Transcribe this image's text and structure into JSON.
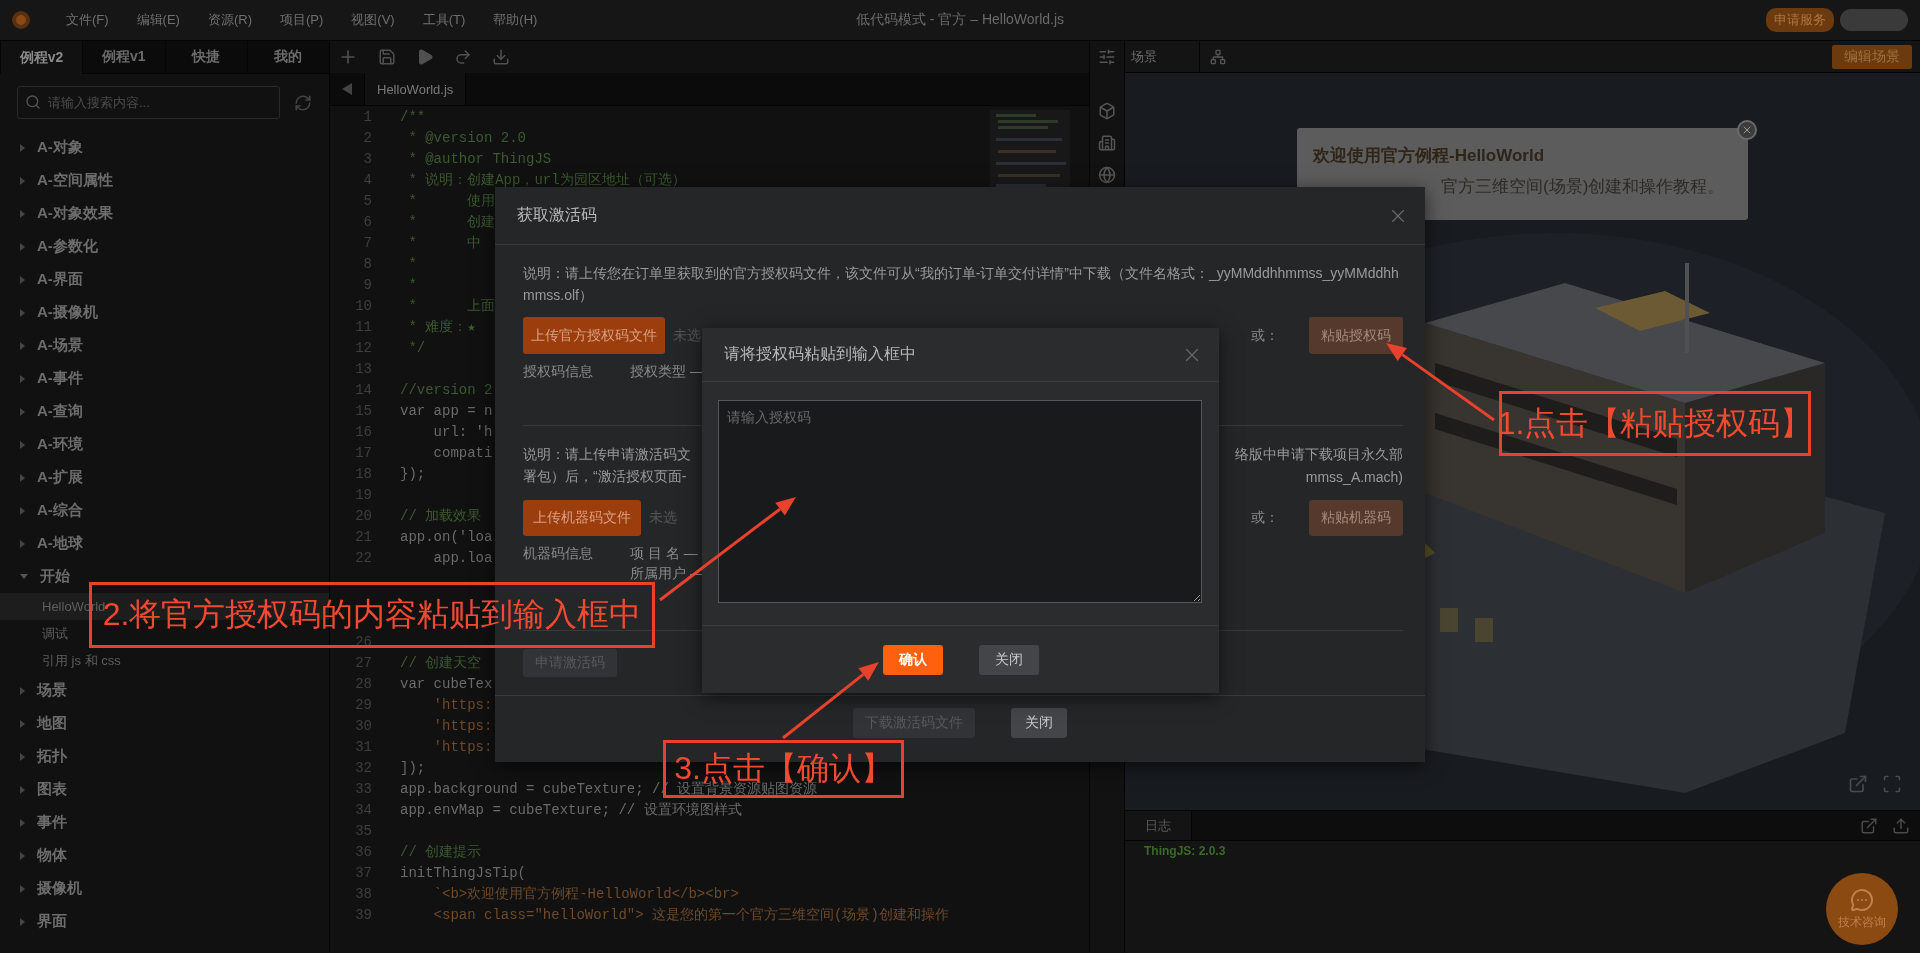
{
  "menu_bar": {
    "items": [
      "文件(F)",
      "编辑(E)",
      "资源(R)",
      "项目(P)",
      "视图(V)",
      "工具(T)",
      "帮助(H)"
    ],
    "title": "低代码模式 - 官方 – HelloWorld.js",
    "service_button": "申请服务"
  },
  "sidebar": {
    "tabs": [
      {
        "label": "例程v2",
        "selected": true
      },
      {
        "label": "例程v1",
        "selected": false
      },
      {
        "label": "快捷",
        "selected": false
      },
      {
        "label": "我的",
        "selected": false
      }
    ],
    "search": {
      "placeholder": "请输入搜索内容..."
    },
    "tree": [
      {
        "label": "A-对象",
        "expanded": false
      },
      {
        "label": "A-空间属性",
        "expanded": false
      },
      {
        "label": "A-对象效果",
        "expanded": false
      },
      {
        "label": "A-参数化",
        "expanded": false
      },
      {
        "label": "A-界面",
        "expanded": false
      },
      {
        "label": "A-摄像机",
        "expanded": false
      },
      {
        "label": "A-场景",
        "expanded": false
      },
      {
        "label": "A-事件",
        "expanded": false
      },
      {
        "label": "A-查询",
        "expanded": false
      },
      {
        "label": "A-环境",
        "expanded": false
      },
      {
        "label": "A-扩展",
        "expanded": false
      },
      {
        "label": "A-综合",
        "expanded": false
      },
      {
        "label": "A-地球",
        "expanded": false
      },
      {
        "label": "开始",
        "expanded": true,
        "children": [
          {
            "label": "HelloWorld",
            "selected": true
          },
          {
            "label": "调试",
            "selected": false
          },
          {
            "label": "引用 js 和 css",
            "selected": false
          }
        ]
      },
      {
        "label": "场景",
        "expanded": false
      },
      {
        "label": "地图",
        "expanded": false
      },
      {
        "label": "拓扑",
        "expanded": false
      },
      {
        "label": "图表",
        "expanded": false
      },
      {
        "label": "事件",
        "expanded": false
      },
      {
        "label": "物体",
        "expanded": false
      },
      {
        "label": "摄像机",
        "expanded": false
      },
      {
        "label": "界面",
        "expanded": false
      }
    ]
  },
  "editor": {
    "file_tab": "HelloWorld.js",
    "lines": [
      {
        "number": "1",
        "kind": "comment",
        "code": "/**"
      },
      {
        "number": "2",
        "kind": "comment",
        "code": " * @version 2.0"
      },
      {
        "number": "3",
        "kind": "comment",
        "code": " * @author ThingJS"
      },
      {
        "number": "4",
        "kind": "comment",
        "code": " * 说明：创建App，url为园区地址（可选）"
      },
      {
        "number": "5",
        "kind": "comment",
        "code": " *      使用"
      },
      {
        "number": "6",
        "kind": "comment",
        "code": " *      创建"
      },
      {
        "number": "7",
        "kind": "comment",
        "code": " *      中"
      },
      {
        "number": "8",
        "kind": "comment",
        "code": " *"
      },
      {
        "number": "9",
        "kind": "comment",
        "code": " *"
      },
      {
        "number": "10",
        "kind": "comment",
        "code": " *      上面"
      },
      {
        "number": "11",
        "kind": "comment",
        "code": " * 难度：★"
      },
      {
        "number": "12",
        "kind": "comment",
        "code": " */"
      },
      {
        "number": "13"
      },
      {
        "number": "14",
        "kind": "comment",
        "code": "//version 2"
      },
      {
        "number": "15",
        "kind": "code",
        "code": "var app = n"
      },
      {
        "number": "16",
        "kind": "code",
        "code": "    url: 'h"
      },
      {
        "number": "17",
        "kind": "code",
        "code": "    compati"
      },
      {
        "number": "18",
        "kind": "code",
        "code": "});"
      },
      {
        "number": "19"
      },
      {
        "number": "20",
        "kind": "comment",
        "code": "// 加载效果"
      },
      {
        "number": "21",
        "kind": "code",
        "code": "app.on('loa"
      },
      {
        "number": "22",
        "kind": "code",
        "code": "    app.loa"
      },
      {
        "number": "26"
      },
      {
        "number": "27",
        "kind": "comment",
        "code": "// 创建天空"
      },
      {
        "number": "28",
        "kind": "code",
        "code": "var cubeTex"
      },
      {
        "number": "29",
        "kind": "string",
        "code": "    'https:"
      },
      {
        "number": "30",
        "kind": "string",
        "code": "    'https:"
      },
      {
        "number": "31",
        "kind": "string",
        "code": "    'https:"
      },
      {
        "number": "32",
        "kind": "code",
        "code": "]);"
      },
      {
        "number": "33",
        "kind": "code",
        "code": "app.background = cubeTexture; // 设置背景资源贴图资源"
      },
      {
        "number": "34",
        "kind": "code",
        "code": "app.envMap = cubeTexture; // 设置环境图样式"
      },
      {
        "number": "35"
      },
      {
        "number": "36",
        "kind": "comment",
        "code": "// 创建提示"
      },
      {
        "number": "37",
        "kind": "code",
        "code": "initThingJsTip("
      },
      {
        "number": "38",
        "kind": "string",
        "code": "    `<b>欢迎使用官方例程-HelloWorld</b><br>"
      },
      {
        "number": "39",
        "kind": "string",
        "code": "    <span class=\"helloWorld\"> 这是您的第一个官方三维空间(场景)创建和操作"
      }
    ]
  },
  "scene": {
    "tab": "场景",
    "edit_button": "编辑场景",
    "tip": {
      "title": "欢迎使用官方例程-HelloWorld",
      "text": "官方三维空间(场景)创建和操作教程。"
    }
  },
  "log": {
    "tab": "日志",
    "lines": [
      "ThingJS: 2.0.3"
    ]
  },
  "help_button": "技术咨询",
  "activation_dialog": {
    "title": "获取激活码",
    "license_section": {
      "description": "说明：请上传您在订单里获取到的官方授权码文件，该文件可从“我的订单-订单交付详情”中下载（文件名格式：_yyMMddhhmmss_yyMMddhhmmss.olf）",
      "upload_button": "上传官方授权码文件",
      "file_status": "未选",
      "or_label": "或：",
      "paste_button": "粘贴授权码",
      "info_label": "授权码信息",
      "info_fields": [
        "授权类型 —"
      ]
    },
    "machine_section": {
      "description_lines": [
        {
          "left": "说明：请上传申请激活码文",
          "right": "络版中申请下载项目永久部"
        },
        {
          "left": "署包）后，“激活授权页面-",
          "right": "mmss_A.mach)"
        }
      ],
      "upload_button": "上传机器码文件",
      "file_status": "未选",
      "or_label": "或：",
      "paste_button": "粘贴机器码",
      "info_label": "机器码信息",
      "info_fields": [
        "项 目 名 —",
        "所属用户 —"
      ]
    },
    "apply_button": {
      "label": "申请激活码",
      "disabled": true
    },
    "footer_buttons": [
      {
        "label": "下载激活码文件",
        "kind": "disabled"
      },
      {
        "label": "关闭",
        "kind": "secondary"
      }
    ]
  },
  "paste_dialog": {
    "title": "请将授权码粘贴到输入框中",
    "input": {
      "placeholder": "请输入授权码"
    },
    "buttons": [
      {
        "label": "确认",
        "kind": "primary"
      },
      {
        "label": "关闭",
        "kind": "secondary"
      }
    ]
  },
  "annotations": [
    {
      "text": "1.点击【粘贴授权码】"
    },
    {
      "text": "2.将官方授权码的内容粘贴到输入框中"
    },
    {
      "text": "3.点击【确认】"
    }
  ]
}
